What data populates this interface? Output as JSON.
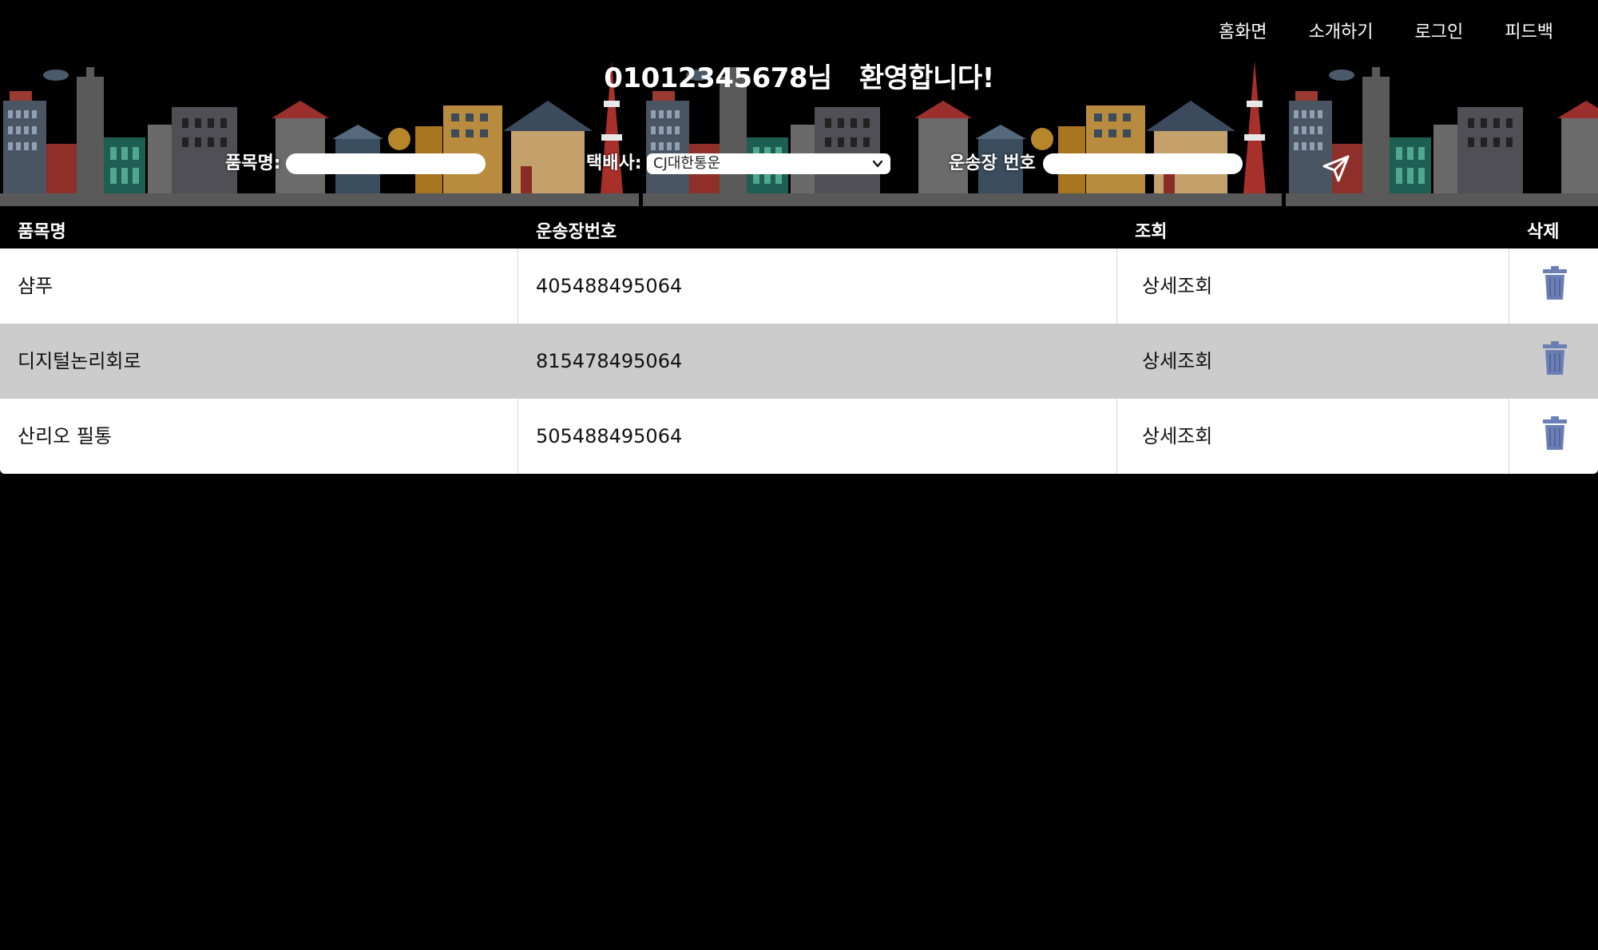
{
  "nav": {
    "items": [
      "홈화면",
      "소개하기",
      "로그인",
      "피드백"
    ]
  },
  "header": {
    "welcome_user": "01012345678님",
    "welcome_text": "환영합니다!"
  },
  "form": {
    "item_label": "품목명:",
    "item_value": "",
    "courier_label": "택배사:",
    "courier_value": "CJ대한통운",
    "tracking_label": "운송장 번호",
    "tracking_value": "",
    "send_icon": "send-icon"
  },
  "table": {
    "headers": [
      "품목명",
      "운송장번호",
      "조회",
      "삭제"
    ],
    "rows": [
      {
        "item": "샴푸",
        "tracking": "405488495064",
        "action": "상세조회"
      },
      {
        "item": "디지털논리회로",
        "tracking": "815478495064",
        "action": "상세조회"
      },
      {
        "item": "산리오 필통",
        "tracking": "505488495064",
        "action": "상세조회"
      }
    ],
    "delete_icon": "trash-icon"
  },
  "colors": {
    "background": "#000000",
    "row_odd": "#ffffff",
    "row_even": "#cccccc",
    "trash": "#6b7fb5"
  }
}
